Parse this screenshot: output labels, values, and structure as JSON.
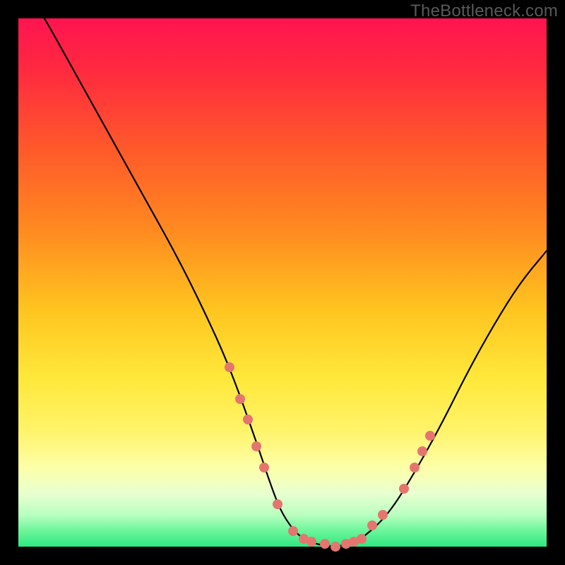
{
  "watermark": "TheBottleneck.com",
  "colors": {
    "background": "#000000",
    "watermark": "#595959",
    "curve": "#000000",
    "marker": "#e4756f",
    "gradient_top": "#ff1450",
    "gradient_mid": "#ffe83a",
    "gradient_bottom": "#2de981"
  },
  "chart_data": {
    "type": "line",
    "title": "",
    "xlabel": "",
    "ylabel": "",
    "x_range": [
      0,
      100
    ],
    "y_range": [
      0,
      100
    ],
    "series": [
      {
        "name": "bottleneck-curve",
        "x": [
          0,
          5,
          10,
          15,
          20,
          25,
          30,
          35,
          40,
          45,
          48,
          50,
          53,
          56,
          60,
          63,
          65,
          70,
          75,
          80,
          85,
          90,
          95,
          100
        ],
        "y": [
          108,
          100,
          91,
          82,
          73,
          64,
          55,
          45,
          34,
          20,
          11,
          6,
          2,
          0.5,
          0,
          0.5,
          1.5,
          6,
          14,
          23,
          33,
          42,
          50,
          56
        ]
      }
    ],
    "markers": {
      "name": "highlighted-points",
      "points": [
        {
          "x": 40,
          "y": 34
        },
        {
          "x": 42,
          "y": 28
        },
        {
          "x": 43.5,
          "y": 24
        },
        {
          "x": 45,
          "y": 19
        },
        {
          "x": 46.5,
          "y": 15
        },
        {
          "x": 49,
          "y": 8
        },
        {
          "x": 52,
          "y": 3
        },
        {
          "x": 54,
          "y": 1.5
        },
        {
          "x": 55.5,
          "y": 1
        },
        {
          "x": 58,
          "y": 0.5
        },
        {
          "x": 60,
          "y": 0
        },
        {
          "x": 62,
          "y": 0.5
        },
        {
          "x": 63.5,
          "y": 1
        },
        {
          "x": 65,
          "y": 1.5
        },
        {
          "x": 67,
          "y": 4
        },
        {
          "x": 69,
          "y": 6
        },
        {
          "x": 73,
          "y": 11
        },
        {
          "x": 75,
          "y": 15
        },
        {
          "x": 76.5,
          "y": 18
        },
        {
          "x": 78,
          "y": 21
        }
      ]
    },
    "annotations": []
  }
}
